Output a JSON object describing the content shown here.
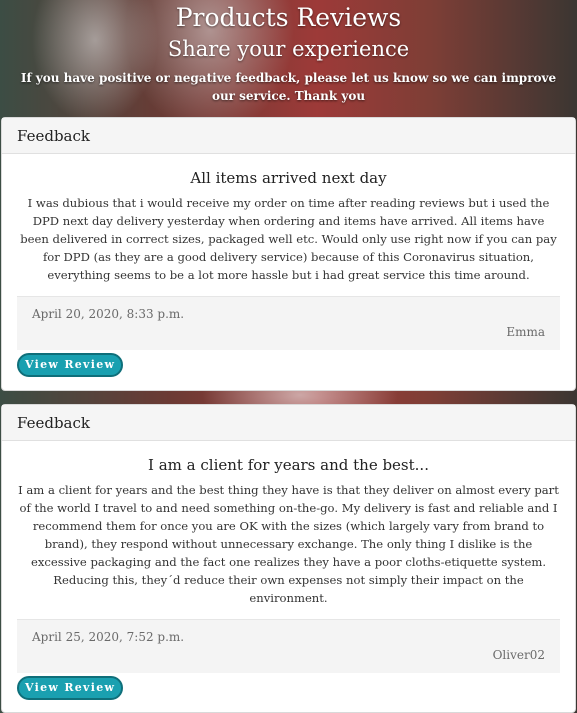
{
  "hero": {
    "title": "Products Reviews",
    "subtitle": "Share your experience",
    "intro": "If you have positive or negative feedback, please let us know so we can improve our service. Thank you"
  },
  "reviews": [
    {
      "header": "Feedback",
      "title": "All items arrived next day",
      "text": "I was dubious that i would receive my order on time after reading reviews but i used the DPD next day delivery yesterday when ordering and items have arrived. All items have been delivered in correct sizes, packaged well etc. Would only use right now if you can pay for DPD (as they are a good delivery service) because of this Coronavirus situation, everything seems to be a lot more hassle but i had great service this time around.",
      "date": "April 20, 2020, 8:33 p.m.",
      "author": "Emma",
      "button": "View Review"
    },
    {
      "header": "Feedback",
      "title": "I am a client for years and the best...",
      "text": "I am a client for years and the best thing they have is that they deliver on almost every part of the world I travel to and need something on-the-go. My delivery is fast and reliable and I recommend them for once you are OK with the sizes (which largely vary from brand to brand), they respond without unnecessary exchange. The only thing I dislike is the excessive packaging and the fact one realizes they have a poor cloths-etiquette system. Reducing this, they´d reduce their own expenses not simply their impact on the environment.",
      "date": "April 25, 2020, 7:52 p.m.",
      "author": "Oliver02",
      "button": "View Review"
    }
  ]
}
